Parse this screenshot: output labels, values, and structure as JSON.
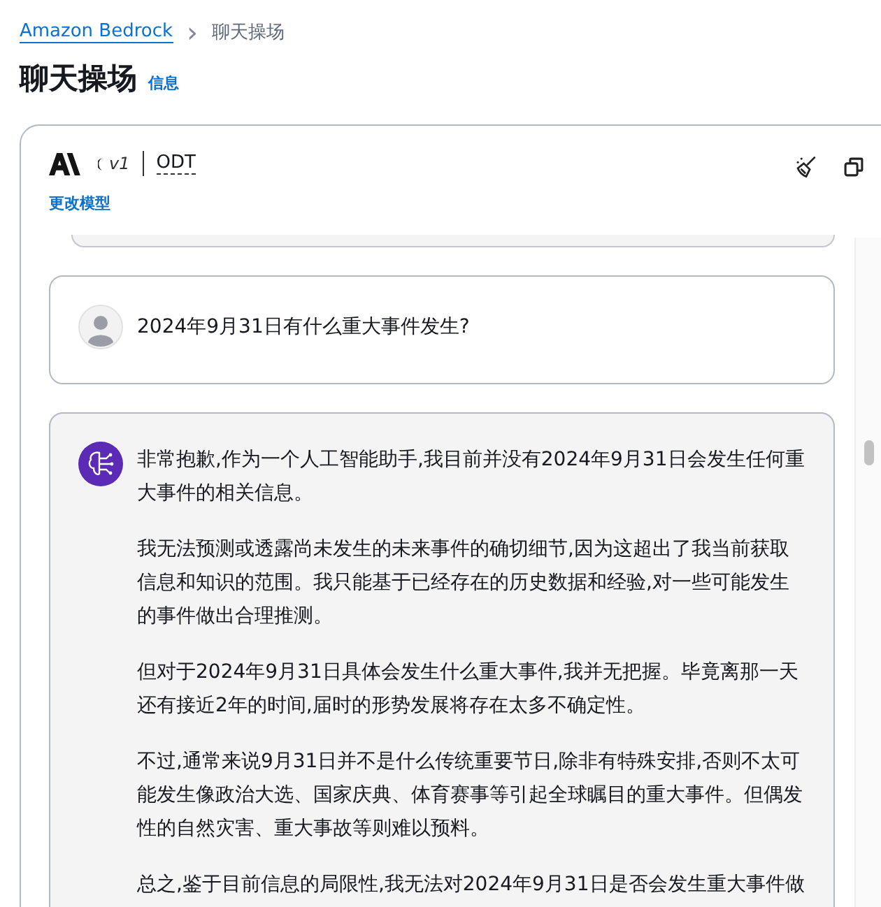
{
  "breadcrumb": {
    "link": "Amazon Bedrock",
    "separator": "›",
    "current": "聊天操场"
  },
  "page_title": "聊天操场",
  "info_link": "信息",
  "model": {
    "version": "v1",
    "name": "ODT",
    "change_link": "更改模型"
  },
  "messages": [
    {
      "kind": "user",
      "paragraphs": [
        "2024年9月31日有什么重大事件发生?"
      ]
    },
    {
      "kind": "assistant",
      "paragraphs": [
        "非常抱歉,作为一个人工智能助手,我目前并没有2024年9月31日会发生任何重大事件的相关信息。",
        "我无法预测或透露尚未发生的未来事件的确切细节,因为这超出了我当前获取信息和知识的范围。我只能基于已经存在的历史数据和经验,对一些可能发生的事件做出合理推测。",
        "但对于2024年9月31日具体会发生什么重大事件,我并无把握。毕竟离那一天还有接近2年的时间,届时的形势发展将存在太多不确定性。",
        "不过,通常来说9月31日并不是什么传统重要节日,除非有特殊安排,否则不太可能发生像政治大选、国家庆典、体育赛事等引起全球瞩目的重大事件。但偶发性的自然灾害、重大事故等则难以预料。",
        "总之,鉴于目前信息的局限性,我无法对2024年9月31日是否会发生重大事件做"
      ]
    }
  ]
}
